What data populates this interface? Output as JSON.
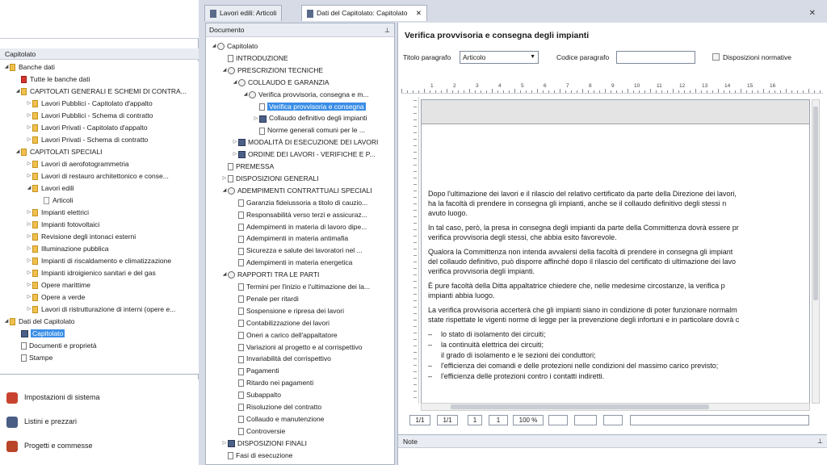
{
  "left_panel": {
    "header": "Capitolato",
    "tree": [
      {
        "label": "Banche dati",
        "level": 0,
        "toggle": "◢",
        "icon": "folder"
      },
      {
        "label": "Tutte le banche dati",
        "level": 1,
        "toggle": "",
        "icon": "folder-red"
      },
      {
        "label": "CAPITOLATI GENERALI E SCHEMI DI CONTRA...",
        "level": 1,
        "toggle": "◢",
        "icon": "folder"
      },
      {
        "label": "Lavori Pubblici - Capitolato d'appalto",
        "level": 2,
        "toggle": "▷",
        "icon": "folder"
      },
      {
        "label": "Lavori Pubblici - Schema di contratto",
        "level": 2,
        "toggle": "▷",
        "icon": "folder"
      },
      {
        "label": "Lavori Privati - Capitolato d'appalto",
        "level": 2,
        "toggle": "▷",
        "icon": "folder"
      },
      {
        "label": "Lavori Privati - Schema di contratto",
        "level": 2,
        "toggle": "▷",
        "icon": "folder"
      },
      {
        "label": "CAPITOLATI SPECIALI",
        "level": 1,
        "toggle": "◢",
        "icon": "folder"
      },
      {
        "label": "Lavori di aerofotogrammetria",
        "level": 2,
        "toggle": "▷",
        "icon": "folder"
      },
      {
        "label": "Lavori di restauro architettonico e conse...",
        "level": 2,
        "toggle": "▷",
        "icon": "folder"
      },
      {
        "label": "Lavori edili",
        "level": 2,
        "toggle": "◢",
        "icon": "folder"
      },
      {
        "label": "Articoli",
        "level": 3,
        "toggle": "",
        "icon": "folder-white"
      },
      {
        "label": "Impianti elettrici",
        "level": 2,
        "toggle": "▷",
        "icon": "folder"
      },
      {
        "label": "Impianti fotovoltaici",
        "level": 2,
        "toggle": "▷",
        "icon": "folder"
      },
      {
        "label": "Revisione degli intonaci esterni",
        "level": 2,
        "toggle": "▷",
        "icon": "folder"
      },
      {
        "label": "Illuminazione pubblica",
        "level": 2,
        "toggle": "▷",
        "icon": "folder"
      },
      {
        "label": "Impianti di riscaldamento e climatizzazione",
        "level": 2,
        "toggle": "▷",
        "icon": "folder"
      },
      {
        "label": "Impianti idroigienico sanitari e del gas",
        "level": 2,
        "toggle": "▷",
        "icon": "folder"
      },
      {
        "label": "Opere marittime",
        "level": 2,
        "toggle": "▷",
        "icon": "folder"
      },
      {
        "label": "Opere a verde",
        "level": 2,
        "toggle": "▷",
        "icon": "folder"
      },
      {
        "label": "Lavori di ristrutturazione di interni (opere e...",
        "level": 2,
        "toggle": "▷",
        "icon": "folder"
      },
      {
        "label": "Dati del Capitolato",
        "level": 0,
        "toggle": "◢",
        "icon": "folder"
      },
      {
        "label": "Capitolato",
        "level": 1,
        "toggle": "",
        "icon": "book",
        "selected": true
      },
      {
        "label": "Documenti e proprietà",
        "level": 1,
        "toggle": "",
        "icon": "page"
      },
      {
        "label": "Stampe",
        "level": 1,
        "toggle": "",
        "icon": "page"
      }
    ],
    "nav": [
      {
        "label": "Impostazioni di sistema",
        "color": "#c8432f"
      },
      {
        "label": "Listini e prezzari",
        "color": "#4a5d85"
      },
      {
        "label": "Progetti e commesse",
        "color": "#b9452b"
      }
    ]
  },
  "tabs": [
    {
      "label": "Lavori edili: Articoli",
      "active": false
    },
    {
      "label": "Dati del Capitolato: Capitolato",
      "active": true
    }
  ],
  "doc_panel": {
    "header": "Documento",
    "pin": "⊥",
    "tree": [
      {
        "label": "Capitolato",
        "level": 0,
        "toggle": "◢",
        "icon": "cloud"
      },
      {
        "label": "INTRODUZIONE",
        "level": 1,
        "toggle": "",
        "icon": "page"
      },
      {
        "label": "PRESCRIZIONI TECNICHE",
        "level": 1,
        "toggle": "◢",
        "icon": "cloud"
      },
      {
        "label": "COLLAUDO E GARANZIA",
        "level": 2,
        "toggle": "◢",
        "icon": "cloud"
      },
      {
        "label": "Verifica provvisoria, consegna e m...",
        "level": 3,
        "toggle": "◢",
        "icon": "cloud"
      },
      {
        "label": "Verifica provvisoria e consegna",
        "level": 4,
        "toggle": "",
        "icon": "page",
        "selected": true
      },
      {
        "label": "Collaudo definitivo degli impianti",
        "level": 4,
        "toggle": "▷",
        "icon": "book"
      },
      {
        "label": "Norme generali comuni per le ...",
        "level": 4,
        "toggle": "",
        "icon": "page"
      },
      {
        "label": "MODALITÀ DI ESECUZIONE DEI LAVORI",
        "level": 2,
        "toggle": "▷",
        "icon": "book"
      },
      {
        "label": "ORDINE DEI LAVORI - VERIFICHE E P...",
        "level": 2,
        "toggle": "▷",
        "icon": "book"
      },
      {
        "label": "PREMESSA",
        "level": 1,
        "toggle": "",
        "icon": "page"
      },
      {
        "label": "DISPOSIZIONI GENERALI",
        "level": 1,
        "toggle": "▷",
        "icon": "page"
      },
      {
        "label": "ADEMPIMENTI CONTRATTUALI SPECIALI",
        "level": 1,
        "toggle": "◢",
        "icon": "cloud"
      },
      {
        "label": "Garanzia fideiussoria a titolo di cauzio...",
        "level": 2,
        "toggle": "",
        "icon": "page"
      },
      {
        "label": "Responsabilità verso terzi e assicuraz...",
        "level": 2,
        "toggle": "",
        "icon": "page"
      },
      {
        "label": "Adempimenti in materia di lavoro dipe...",
        "level": 2,
        "toggle": "",
        "icon": "page"
      },
      {
        "label": "Adempimenti in materia antimafia",
        "level": 2,
        "toggle": "",
        "icon": "page"
      },
      {
        "label": "Sicurezza e salute dei lavoratori nel ...",
        "level": 2,
        "toggle": "",
        "icon": "page"
      },
      {
        "label": "Adempimenti in materia energetica",
        "level": 2,
        "toggle": "",
        "icon": "page"
      },
      {
        "label": "RAPPORTI TRA LE PARTI",
        "level": 1,
        "toggle": "◢",
        "icon": "cloud"
      },
      {
        "label": "Termini per l'inizio e l'ultimazione dei la...",
        "level": 2,
        "toggle": "",
        "icon": "page"
      },
      {
        "label": "Penale per ritardi",
        "level": 2,
        "toggle": "",
        "icon": "page"
      },
      {
        "label": "Sospensione e ripresa dei lavori",
        "level": 2,
        "toggle": "",
        "icon": "page"
      },
      {
        "label": "Contabilizzazione dei lavori",
        "level": 2,
        "toggle": "",
        "icon": "page"
      },
      {
        "label": "Oneri a carico dell'appaltatore",
        "level": 2,
        "toggle": "",
        "icon": "page"
      },
      {
        "label": "Variazioni al progetto e al corrispettivo",
        "level": 2,
        "toggle": "",
        "icon": "page"
      },
      {
        "label": "Invariabilità del corrispettivo",
        "level": 2,
        "toggle": "",
        "icon": "page"
      },
      {
        "label": "Pagamenti",
        "level": 2,
        "toggle": "",
        "icon": "page"
      },
      {
        "label": "Ritardo nei pagamenti",
        "level": 2,
        "toggle": "",
        "icon": "page"
      },
      {
        "label": "Subappalto",
        "level": 2,
        "toggle": "",
        "icon": "page"
      },
      {
        "label": "Risoluzione del contratto",
        "level": 2,
        "toggle": "",
        "icon": "page"
      },
      {
        "label": "Collaudo e manutenzione",
        "level": 2,
        "toggle": "",
        "icon": "page"
      },
      {
        "label": "Controversie",
        "level": 2,
        "toggle": "",
        "icon": "page"
      },
      {
        "label": "DISPOSIZIONI FINALI",
        "level": 1,
        "toggle": "▷",
        "icon": "book"
      },
      {
        "label": "Fasi di esecuzione",
        "level": 1,
        "toggle": "",
        "icon": "page"
      }
    ]
  },
  "editor": {
    "title": "Verifica provvisoria e consegna degli impianti",
    "titolo_label": "Titolo paragrafo",
    "titolo_value": "Articolo",
    "codice_label": "Codice paragrafo",
    "codice_value": "",
    "disposizioni_label": "Disposizioni normative",
    "ruler_numbers": [
      "1",
      "2",
      "3",
      "4",
      "5",
      "6",
      "7",
      "8",
      "9",
      "10",
      "11",
      "12",
      "13",
      "14",
      "15",
      "16"
    ],
    "paragraphs": [
      [
        "Dopo l'ultimazione dei lavori e il rilascio del relativo certificato da parte della Direzione dei lavori,",
        "ha la facoltà di prendere in consegna gli impianti, anche se il collaudo definitivo degli stessi n",
        "avuto luogo."
      ],
      [
        "In tal caso, però, la presa in consegna degli impianti da parte della Committenza dovrà essere pr",
        "verifica provvisoria degli stessi, che abbia esito favorevole."
      ],
      [
        "Qualora la Committenza non intenda avvalersi della facoltà di prendere in consegna gli impiant",
        "del collaudo definitivo, può disporre affinché dopo il rilascio del certificato di ultimazione dei lavo",
        "verifica provvisoria degli impianti."
      ],
      [
        "È pure facoltà della Ditta appaltatrice chiedere che, nelle medesime circostanze, la verifica p",
        "impianti abbia luogo."
      ],
      [
        "La verifica provvisoria accerterà che gli impianti siano in condizione di poter funzionare normalm",
        "state rispettate le vigenti norme di legge per la prevenzione degli infortuni e in particolare dovrà c"
      ]
    ],
    "list_items": [
      {
        "dash": "–",
        "text": "lo stato di isolamento dei circuiti;"
      },
      {
        "dash": "–",
        "text": "la continuità elettrica dei circuiti;"
      },
      {
        "dash": "",
        "text": "il grado di isolamento e le sezioni dei conduttori;"
      },
      {
        "dash": "–",
        "text": "l'efficienza dei comandi e delle protezioni nelle condizioni del massimo carico previsto;"
      },
      {
        "dash": "–",
        "text": "l'efficienza delle protezioni contro i contatti indiretti."
      }
    ],
    "status": {
      "pages": "1/1",
      "sections": "1/1",
      "line": "1",
      "col": "1",
      "zoom": "100 %"
    },
    "notes_header": "Note",
    "notes_pin": "⊥"
  }
}
